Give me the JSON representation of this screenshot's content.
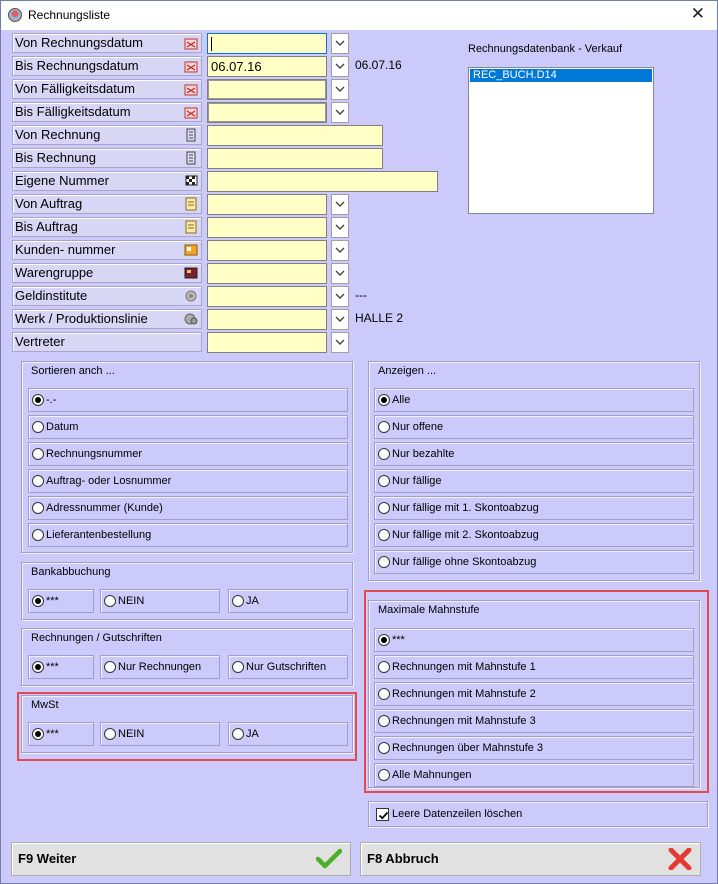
{
  "window": {
    "title": "Rechnungsliste",
    "close": "✕"
  },
  "filters": [
    {
      "label": "Von Rechnungsdatum",
      "icon": "calendar-icon",
      "value": ""
    },
    {
      "label": "Bis Rechnungsdatum",
      "icon": "calendar-icon",
      "value": "06.07.16",
      "side": "06.07.16"
    },
    {
      "label": "Von Fälligkeitsdatum",
      "icon": "calendar-icon",
      "value": ""
    },
    {
      "label": "Bis Fälligkeitsdatum",
      "icon": "calendar-icon",
      "value": ""
    },
    {
      "label": "Von Rechnung",
      "icon": "invoice-icon",
      "value": ""
    },
    {
      "label": "Bis Rechnung",
      "icon": "invoice-icon",
      "value": ""
    },
    {
      "label": "Eigene Nummer",
      "icon": "checkered-flag-icon",
      "value": ""
    },
    {
      "label": "Von Auftrag",
      "icon": "order-icon",
      "value": ""
    },
    {
      "label": "Bis Auftrag",
      "icon": "order-icon",
      "value": ""
    },
    {
      "label": "Kunden- nummer",
      "icon": "contact-card-icon",
      "value": ""
    },
    {
      "label": "Warengruppe",
      "icon": "product-group-icon",
      "value": ""
    },
    {
      "label": "Geldinstitute",
      "icon": "bank-icon",
      "value": "",
      "side": "---"
    },
    {
      "label": "Werk / Produktionslinie",
      "icon": "factory-icon",
      "value": "",
      "side": "HALLE 2"
    },
    {
      "label": "Vertreter",
      "icon": "",
      "value": ""
    }
  ],
  "database": {
    "title": "Rechnungsdatenbank - Verkauf",
    "items": [
      "REC_BUCH.D14"
    ]
  },
  "sort": {
    "title": "Sortieren anch ...",
    "options": [
      "-.-",
      "Datum",
      "Rechnungsnummer",
      "Auftrag- oder Losnummer",
      "Adressnummer (Kunde)",
      "Lieferantenbestellung"
    ],
    "selected": 0
  },
  "show": {
    "title": "Anzeigen ...",
    "options": [
      "Alle",
      "Nur offene",
      "Nur bezahlte",
      "Nur fällige",
      "Nur fällige mit 1. Skontoabzug",
      "Nur fällige mit 2. Skontoabzug",
      "Nur fällige ohne Skontoabzug"
    ],
    "selected": 0
  },
  "bank": {
    "title": "Bankabbuchung",
    "options": [
      "***",
      "NEIN",
      "JA"
    ],
    "selected": 0
  },
  "invoices": {
    "title": "Rechnungen / Gutschriften",
    "options": [
      "***",
      "Nur Rechnungen",
      "Nur Gutschriften"
    ],
    "selected": 0
  },
  "vat": {
    "title": "MwSt",
    "options": [
      "***",
      "NEIN",
      "JA"
    ],
    "selected": 0
  },
  "dunning": {
    "title": "Maximale Mahnstufe",
    "options": [
      "***",
      "Rechnungen mit Mahnstufe 1",
      "Rechnungen mit Mahnstufe 2",
      "Rechnungen mit Mahnstufe 3",
      "Rechnungen über Mahnstufe 3",
      "Alle Mahnungen"
    ],
    "selected": 0
  },
  "clear_empty": {
    "label": "Leere Datenzeilen löschen",
    "checked": true
  },
  "buttons": {
    "continue": "F9 Weiter",
    "cancel": "F8 Abbruch"
  },
  "colors": {
    "background": "#cccafb",
    "input": "#ffffc6",
    "selection": "#0078d7",
    "highlight": "#e24a4f",
    "ok": "#4caf2a",
    "cancel": "#e53935"
  }
}
